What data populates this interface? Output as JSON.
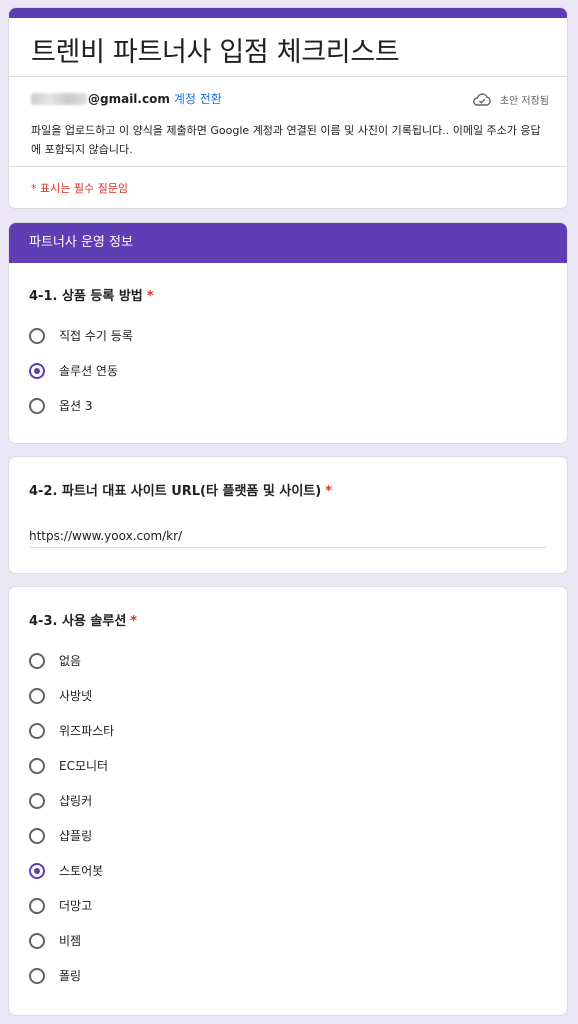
{
  "form": {
    "title": "트렌비 파트너사 입점 체크리스트",
    "email_domain": "@gmail.com",
    "switch_account": "계정 전환",
    "draft_status": "초안 저장됨",
    "notice": "파일을 업로드하고 이 양식을 제출하면 Google 계정과 연결된 이름 및 사진이 기록됩니다.. 이메일 주소가 응답에 포함되지 않습니다.",
    "required_note": "* 표시는 필수 질문임"
  },
  "section": {
    "title": "파트너사 운영 정보"
  },
  "q1": {
    "title": "4-1. 상품 등록 방법",
    "required_mark": "*",
    "options": [
      "직접 수기 등록",
      "솔루션 연동",
      "옵션 3"
    ],
    "selected_index": 1
  },
  "q2": {
    "title": "4-2. 파트너 대표 사이트 URL(타 플랫폼 및 사이트)",
    "required_mark": "*",
    "value": "https://www.yoox.com/kr/"
  },
  "q3": {
    "title": "4-3. 사용 솔루션",
    "required_mark": "*",
    "options": [
      "없음",
      "사방넷",
      "위즈파스타",
      "EC모니터",
      "샵링커",
      "샵플링",
      "스토어봇",
      "더망고",
      "비젬",
      "폴링"
    ],
    "selected_index": 6
  },
  "colors": {
    "accent": "#5f3eb5",
    "background": "#ece7f6",
    "required": "#d93025",
    "link": "#1a73e8"
  }
}
